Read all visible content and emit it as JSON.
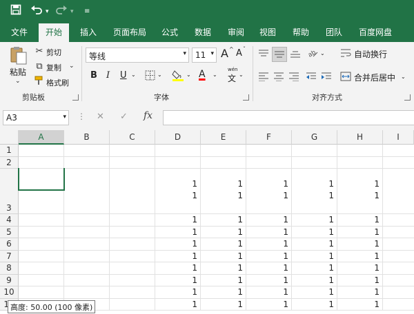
{
  "quick_access": {
    "save_icon": "save-icon",
    "undo_icon": "undo-icon",
    "redo_icon": "redo-icon",
    "customize_icon": "dropdown-icon"
  },
  "tabs": [
    {
      "label": "文件"
    },
    {
      "label": "开始",
      "active": true
    },
    {
      "label": "插入"
    },
    {
      "label": "页面布局"
    },
    {
      "label": "公式"
    },
    {
      "label": "数据"
    },
    {
      "label": "审阅"
    },
    {
      "label": "视图"
    },
    {
      "label": "帮助"
    },
    {
      "label": "团队"
    },
    {
      "label": "百度网盘"
    }
  ],
  "ribbon": {
    "clipboard": {
      "paste": "粘贴",
      "cut": "剪切",
      "copy": "复制",
      "format_painter": "格式刷",
      "group_label": "剪贴板"
    },
    "font": {
      "font_name": "等线",
      "font_size": "11",
      "grow": "A",
      "shrink": "A",
      "bold": "B",
      "italic": "I",
      "underline": "U",
      "color_letter": "A",
      "wen": "wén",
      "wen_char": "文",
      "group_label": "字体",
      "fill_color": "#ffff00",
      "font_color": "#ff0000"
    },
    "alignment": {
      "wrap_text": "自动换行",
      "merge_center": "合并后居中",
      "group_label": "对齐方式"
    }
  },
  "formula_bar": {
    "name_box": "A3",
    "fx": "fx",
    "cancel": "✕",
    "enter": "✓",
    "content": ""
  },
  "sheet": {
    "columns": [
      "A",
      "B",
      "C",
      "D",
      "E",
      "F",
      "G",
      "H",
      "I"
    ],
    "selected_column": "A",
    "rows": [
      {
        "label": "1",
        "values": [
          "",
          "",
          "",
          "",
          "",
          "",
          "",
          ""
        ]
      },
      {
        "label": "2",
        "values": [
          "",
          "",
          "",
          "",
          "",
          "",
          "",
          ""
        ]
      },
      {
        "label": "3",
        "values": [
          "",
          "",
          "",
          "1",
          "1",
          "1",
          "1",
          "1"
        ],
        "second_line": [
          "",
          "",
          "",
          "1",
          "1",
          "1",
          "1",
          "1"
        ],
        "tall": true
      },
      {
        "label": "4",
        "values": [
          "",
          "",
          "",
          "1",
          "1",
          "1",
          "1",
          "1"
        ]
      },
      {
        "label": "5",
        "values": [
          "",
          "",
          "",
          "1",
          "1",
          "1",
          "1",
          "1"
        ]
      },
      {
        "label": "6",
        "values": [
          "",
          "",
          "",
          "1",
          "1",
          "1",
          "1",
          "1"
        ]
      },
      {
        "label": "7",
        "values": [
          "",
          "",
          "",
          "1",
          "1",
          "1",
          "1",
          "1"
        ]
      },
      {
        "label": "8",
        "values": [
          "",
          "",
          "",
          "1",
          "1",
          "1",
          "1",
          "1"
        ]
      },
      {
        "label": "9",
        "values": [
          "",
          "",
          "",
          "1",
          "1",
          "1",
          "1",
          "1"
        ]
      },
      {
        "label": "10",
        "values": [
          "",
          "",
          "",
          "1",
          "1",
          "1",
          "1",
          "1"
        ]
      },
      {
        "label": "11",
        "values": [
          "",
          "",
          "",
          "1",
          "1",
          "1",
          "1",
          "1"
        ]
      }
    ],
    "tooltip": "高度: 50.00 (100 像素)"
  },
  "colors": {
    "brand": "#217346",
    "ribbon_bg": "#f3f3f3"
  }
}
